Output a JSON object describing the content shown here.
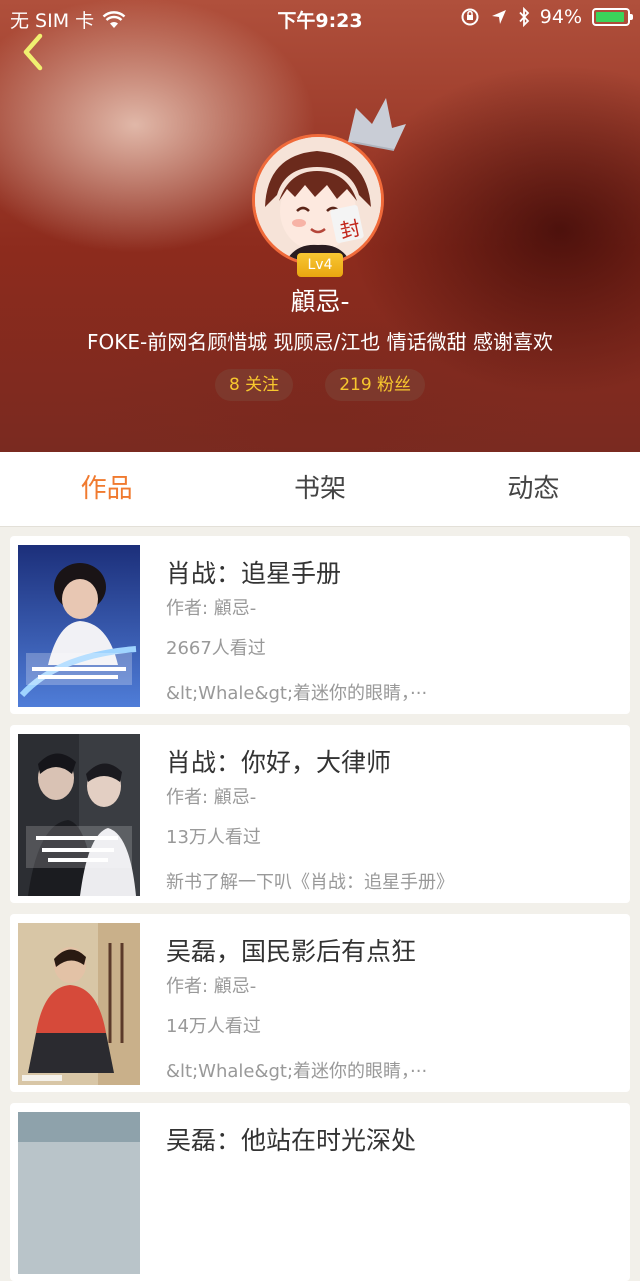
{
  "status_bar": {
    "carrier": "无 SIM 卡",
    "time": "下午9:23",
    "battery": "94%",
    "battery_level": 0.94,
    "battery_color": "#3bd45a"
  },
  "profile": {
    "level": "Lv4",
    "name": "顧忌-",
    "bio": "FOKE-前网名顾惜城 现顾忌/江也 情话微甜 感谢喜欢",
    "following": "8 关注",
    "followers": "219 粉丝",
    "accent_color": "#f7c72e"
  },
  "tabs": [
    {
      "label": "作品",
      "active": true
    },
    {
      "label": "书架",
      "active": false
    },
    {
      "label": "动态",
      "active": false
    }
  ],
  "books": [
    {
      "title": "肖战：追星手册",
      "author": "作者: 顧忌-",
      "views": "2667人看过",
      "desc": "&lt;Whale&gt;着迷你的眼睛，···"
    },
    {
      "title": "肖战：你好，大律师",
      "author": "作者: 顧忌-",
      "views": "13万人看过",
      "desc": "新书了解一下叭《肖战：追星手册》"
    },
    {
      "title": "吴磊，国民影后有点狂",
      "author": "作者: 顧忌-",
      "views": "14万人看过",
      "desc": "&lt;Whale&gt;着迷你的眼睛，···"
    },
    {
      "title": "吴磊：他站在时光深处",
      "author": "",
      "views": "",
      "desc": ""
    }
  ],
  "colors": {
    "active_tab": "#f07a2f",
    "avatar_ring": "#f06a3a"
  }
}
